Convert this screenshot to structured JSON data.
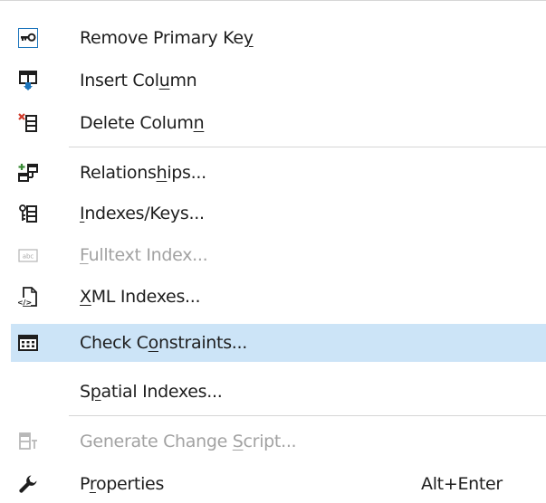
{
  "menu": {
    "items": [
      {
        "id": "remove-primary-key",
        "label": "Remove Primary Key",
        "mnemonic_index": 17,
        "icon": "key-icon",
        "enabled": true
      },
      {
        "id": "insert-column",
        "label": "Insert Column",
        "mnemonic_index": 10,
        "icon": "insert-column-icon",
        "enabled": true
      },
      {
        "id": "delete-column",
        "label": "Delete Column",
        "mnemonic_index": 12,
        "icon": "delete-column-icon",
        "enabled": true
      },
      {
        "id": "relationships",
        "label": "Relationships...",
        "mnemonic_index": 9,
        "icon": "relationships-icon",
        "enabled": true
      },
      {
        "id": "indexes-keys",
        "label": "Indexes/Keys...",
        "mnemonic_index": 0,
        "icon": "indexes-keys-icon",
        "enabled": true
      },
      {
        "id": "fulltext-index",
        "label": "Fulltext Index...",
        "mnemonic_index": 0,
        "icon": "fulltext-index-icon",
        "enabled": false
      },
      {
        "id": "xml-indexes",
        "label": "XML Indexes...",
        "mnemonic_index": 0,
        "icon": "xml-indexes-icon",
        "enabled": true
      },
      {
        "id": "check-constraints",
        "label": "Check Constraints...",
        "mnemonic_index": 7,
        "icon": "check-constraints-icon",
        "enabled": true,
        "highlighted": true
      },
      {
        "id": "spatial-indexes",
        "label": "Spatial Indexes...",
        "mnemonic_index": 1,
        "icon": "",
        "enabled": true
      },
      {
        "id": "generate-change-script",
        "label": "Generate Change Script...",
        "mnemonic_index": 16,
        "icon": "generate-script-icon",
        "enabled": false
      },
      {
        "id": "properties",
        "label": "Properties",
        "mnemonic_index": 1,
        "icon": "wrench-icon",
        "enabled": true,
        "shortcut": "Alt+Enter"
      }
    ]
  },
  "colors": {
    "highlight": "#cce4f7",
    "text": "#1e1e1e",
    "disabled_text": "#a2a2a2",
    "separator": "#d6d6d6",
    "accent_blue": "#1c75bc",
    "delete_red": "#d03a2a",
    "add_green": "#388a34"
  }
}
